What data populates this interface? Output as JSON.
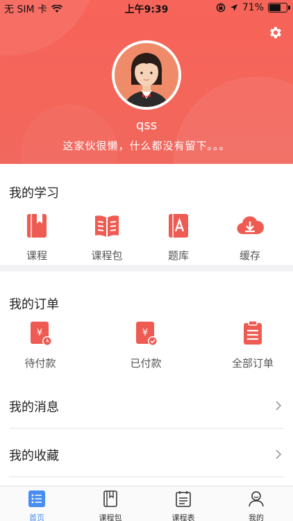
{
  "status_bar": {
    "carrier": "无 SIM 卡",
    "time": "上午9:39",
    "battery": "71%",
    "battery_level": 0.71
  },
  "profile": {
    "username": "qss",
    "motto": "这家伙很懒，什么都没有留下。。。",
    "settings_icon": "gear-icon"
  },
  "my_learning": {
    "title": "我的学习",
    "items": [
      {
        "label": "课程",
        "icon": "book-icon"
      },
      {
        "label": "课程包",
        "icon": "open-book-icon"
      },
      {
        "label": "题库",
        "icon": "question-bank-icon"
      },
      {
        "label": "缓存",
        "icon": "cloud-download-icon"
      }
    ]
  },
  "my_orders": {
    "title": "我的订单",
    "items": [
      {
        "label": "待付款",
        "icon": "pending-payment-icon"
      },
      {
        "label": "已付款",
        "icon": "paid-icon"
      },
      {
        "label": "全部订单",
        "icon": "clipboard-icon"
      }
    ]
  },
  "rows": {
    "messages": "我的消息",
    "favorites": "我的收藏"
  },
  "tab_bar": {
    "items": [
      {
        "label": "首页",
        "icon": "list-icon",
        "active": true
      },
      {
        "label": "课程包",
        "icon": "book-icon",
        "active": false
      },
      {
        "label": "课程表",
        "icon": "schedule-icon",
        "active": false
      },
      {
        "label": "我的",
        "icon": "person-icon",
        "active": false
      }
    ]
  },
  "colors": {
    "accent": "#f4655a",
    "icon_red": "#ee5b52",
    "tab_active": "#4a8df0"
  }
}
